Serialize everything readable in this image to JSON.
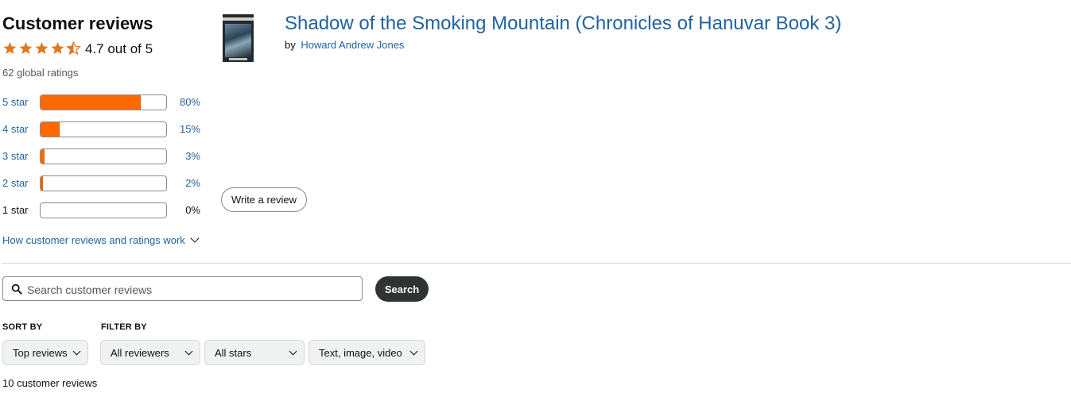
{
  "ratings": {
    "heading": "Customer reviews",
    "average_text": "4.7 out of 5",
    "average_value": 4.7,
    "global_text": "62 global ratings",
    "star_color": "#de7921",
    "histogram": [
      {
        "label": "5 star",
        "pct_text": "80%",
        "pct": 80,
        "link": true
      },
      {
        "label": "4 star",
        "pct_text": "15%",
        "pct": 15,
        "link": true
      },
      {
        "label": "3 star",
        "pct_text": "3%",
        "pct": 3,
        "link": true
      },
      {
        "label": "2 star",
        "pct_text": "2%",
        "pct": 2,
        "link": true
      },
      {
        "label": "1 star",
        "pct_text": "0%",
        "pct": 0,
        "link": false
      }
    ],
    "bar_color": "#ff6a00",
    "how_link": "How customer reviews and ratings work"
  },
  "book": {
    "title": "Shadow of the Smoking Mountain (Chronicles of Hanuvar Book 3)",
    "by": "by",
    "author": "Howard Andrew Jones"
  },
  "write_review": "Write a review",
  "search": {
    "placeholder": "Search customer reviews",
    "button": "Search",
    "icon": "search-icon"
  },
  "sort": {
    "caption": "SORT BY",
    "selected": "Top reviews"
  },
  "filter": {
    "caption": "FILTER BY",
    "reviewers": "All reviewers",
    "stars": "All stars",
    "media": "Text, image, video"
  },
  "review_count": "10 customer reviews",
  "link_color": "#2162a1"
}
